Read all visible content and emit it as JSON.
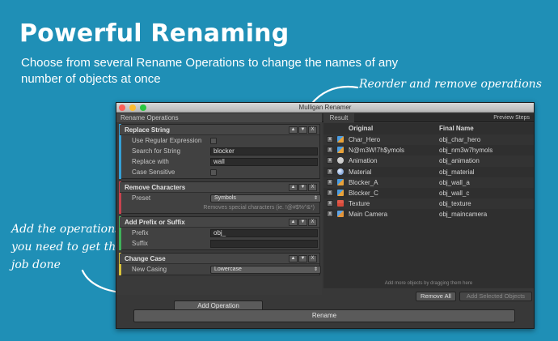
{
  "headline": "Powerful Renaming",
  "subtitle": "Choose from several Rename Operations to change the names of any number of objects at once",
  "callouts": {
    "top": "Reorder and remove operations",
    "left": "Add the operations you need to get the job done"
  },
  "window": {
    "title": "Mulligan Renamer",
    "ops_tab": "Rename Operations",
    "result_tab": "Result",
    "preview_steps": "Preview Steps"
  },
  "ops": {
    "replace": {
      "title": "Replace String",
      "use_regex_label": "Use Regular Expression",
      "search_label": "Search for String",
      "search_value": "blocker",
      "replace_label": "Replace with",
      "replace_value": "wall",
      "case_label": "Case Sensitive"
    },
    "remove": {
      "title": "Remove Characters",
      "preset_label": "Preset",
      "preset_value": "Symbols",
      "hint": "Removes special characters (ie. !@#$%^&*)"
    },
    "prefix": {
      "title": "Add Prefix or Suffix",
      "prefix_label": "Prefix",
      "prefix_value": "obj_",
      "suffix_label": "Suffix",
      "suffix_value": ""
    },
    "case": {
      "title": "Change Case",
      "casing_label": "New Casing",
      "casing_value": "Lowercase"
    },
    "controls": {
      "up": "▲",
      "down": "▼",
      "close": "X"
    },
    "add_button": "Add Operation"
  },
  "results": {
    "col_original": "Original",
    "col_final": "Final Name",
    "remove_glyph": "x",
    "rows": [
      {
        "original": "Char_Hero",
        "final": "obj_char_hero",
        "icon": "prefab-icon"
      },
      {
        "original": "N@m3W!7h$ymols",
        "final": "obj_nm3w7hymols",
        "icon": "prefab-icon"
      },
      {
        "original": "Animation",
        "final": "obj_animation",
        "icon": "animation-icon"
      },
      {
        "original": "Material",
        "final": "obj_material",
        "icon": "material-icon"
      },
      {
        "original": "Blocker_A",
        "final": "obj_wall_a",
        "icon": "prefab-icon"
      },
      {
        "original": "Blocker_C",
        "final": "obj_wall_c",
        "icon": "prefab-icon"
      },
      {
        "original": "Texture",
        "final": "obj_texture",
        "icon": "texture-icon"
      },
      {
        "original": "Main Camera",
        "final": "obj_maincamera",
        "icon": "gameobject-icon"
      }
    ],
    "footer": "Add more objects by dragging them here",
    "remove_all": "Remove All",
    "add_selected": "Add Selected Objects"
  },
  "rename_button": "Rename",
  "colors": {
    "background": "#1f8fb6",
    "replace_stripe": "#35a0d6",
    "remove_stripe": "#c8434e",
    "prefix_stripe": "#3fb25a",
    "case_stripe": "#d8c23a"
  }
}
